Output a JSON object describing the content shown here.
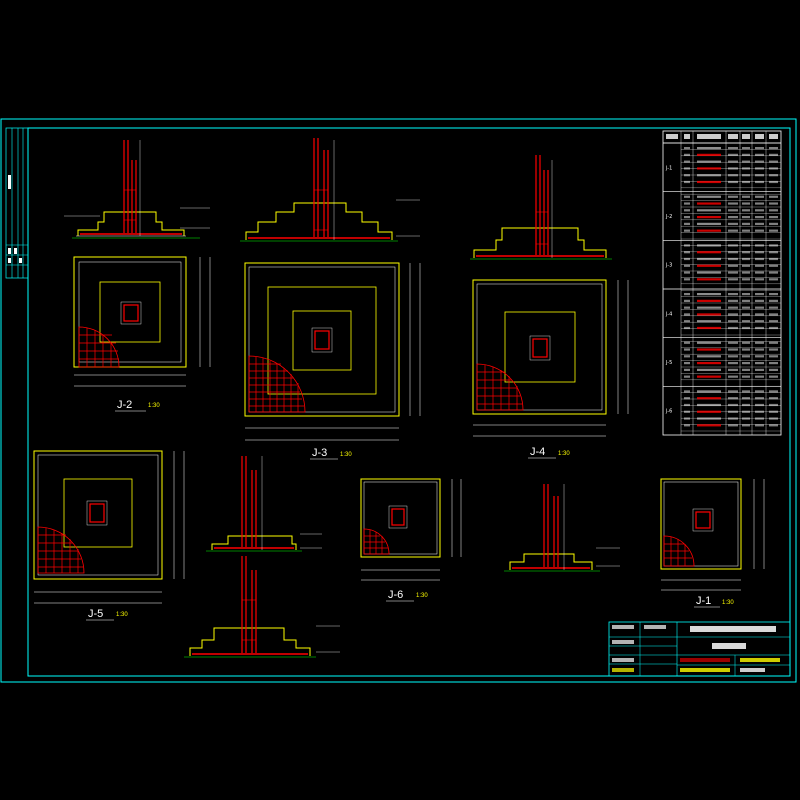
{
  "drawing": {
    "colors": {
      "background": "#000000",
      "frame": "#00ffff",
      "concrete_outline": "#ffff00",
      "rebar": "#ff0000",
      "dimension": "#ffffff",
      "ground": "#00ff00"
    }
  },
  "details": [
    {
      "id": "J-2",
      "label": "J-2",
      "scale": "1:30"
    },
    {
      "id": "J-3",
      "label": "J-3",
      "scale": "1:30"
    },
    {
      "id": "J-4",
      "label": "J-4",
      "scale": "1:30"
    },
    {
      "id": "J-5",
      "label": "J-5",
      "scale": "1:30"
    },
    {
      "id": "J-6",
      "label": "J-6",
      "scale": "1:30"
    },
    {
      "id": "J-1",
      "label": "J-1",
      "scale": "1:30"
    }
  ],
  "rebar_schedule": {
    "groups": [
      {
        "label": "J-1"
      },
      {
        "label": "J-2"
      },
      {
        "label": "J-3"
      },
      {
        "label": "J-4"
      },
      {
        "label": "J-5"
      },
      {
        "label": "J-6"
      }
    ]
  }
}
